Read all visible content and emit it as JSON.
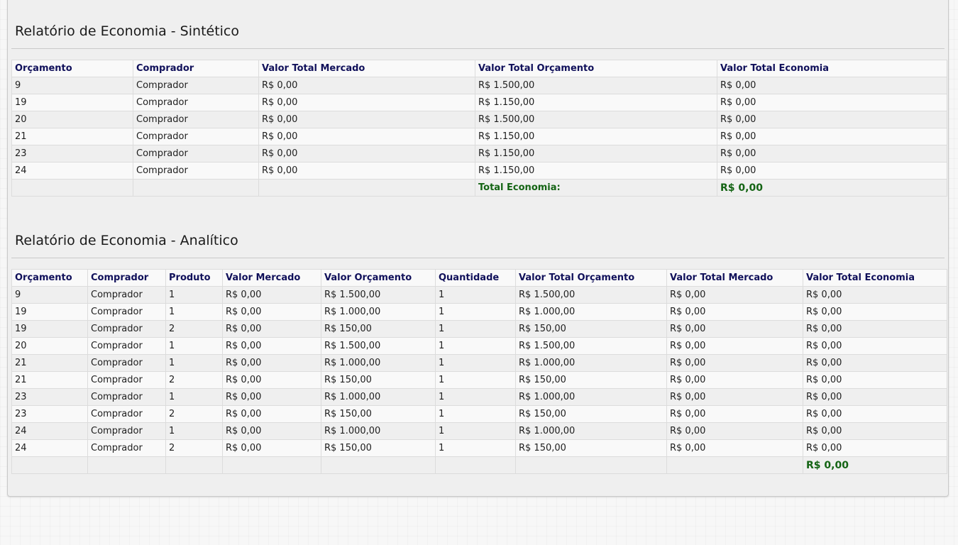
{
  "synthetic": {
    "title": "Relatório de Economia - Sintético",
    "columns": [
      "Orçamento",
      "Comprador",
      "Valor Total Mercado",
      "Valor Total Orçamento",
      "Valor Total Economia"
    ],
    "rows": [
      [
        "9",
        "Comprador",
        "R$ 0,00",
        "R$ 1.500,00",
        "R$ 0,00"
      ],
      [
        "19",
        "Comprador",
        "R$ 0,00",
        "R$ 1.150,00",
        "R$ 0,00"
      ],
      [
        "20",
        "Comprador",
        "R$ 0,00",
        "R$ 1.500,00",
        "R$ 0,00"
      ],
      [
        "21",
        "Comprador",
        "R$ 0,00",
        "R$ 1.150,00",
        "R$ 0,00"
      ],
      [
        "23",
        "Comprador",
        "R$ 0,00",
        "R$ 1.150,00",
        "R$ 0,00"
      ],
      [
        "24",
        "Comprador",
        "R$ 0,00",
        "R$ 1.150,00",
        "R$ 0,00"
      ]
    ],
    "total_label": "Total Economia:",
    "total_value": "R$ 0,00"
  },
  "analytic": {
    "title": "Relatório de Economia - Analítico",
    "columns": [
      "Orçamento",
      "Comprador",
      "Produto",
      "Valor Mercado",
      "Valor Orçamento",
      "Quantidade",
      "Valor Total Orçamento",
      "Valor Total Mercado",
      "Valor Total Economia"
    ],
    "rows": [
      [
        "9",
        "Comprador",
        "1",
        "R$ 0,00",
        "R$ 1.500,00",
        "1",
        "R$ 1.500,00",
        "R$ 0,00",
        "R$ 0,00"
      ],
      [
        "19",
        "Comprador",
        "1",
        "R$ 0,00",
        "R$ 1.000,00",
        "1",
        "R$ 1.000,00",
        "R$ 0,00",
        "R$ 0,00"
      ],
      [
        "19",
        "Comprador",
        "2",
        "R$ 0,00",
        "R$ 150,00",
        "1",
        "R$ 150,00",
        "R$ 0,00",
        "R$ 0,00"
      ],
      [
        "20",
        "Comprador",
        "1",
        "R$ 0,00",
        "R$ 1.500,00",
        "1",
        "R$ 1.500,00",
        "R$ 0,00",
        "R$ 0,00"
      ],
      [
        "21",
        "Comprador",
        "1",
        "R$ 0,00",
        "R$ 1.000,00",
        "1",
        "R$ 1.000,00",
        "R$ 0,00",
        "R$ 0,00"
      ],
      [
        "21",
        "Comprador",
        "2",
        "R$ 0,00",
        "R$ 150,00",
        "1",
        "R$ 150,00",
        "R$ 0,00",
        "R$ 0,00"
      ],
      [
        "23",
        "Comprador",
        "1",
        "R$ 0,00",
        "R$ 1.000,00",
        "1",
        "R$ 1.000,00",
        "R$ 0,00",
        "R$ 0,00"
      ],
      [
        "23",
        "Comprador",
        "2",
        "R$ 0,00",
        "R$ 150,00",
        "1",
        "R$ 150,00",
        "R$ 0,00",
        "R$ 0,00"
      ],
      [
        "24",
        "Comprador",
        "1",
        "R$ 0,00",
        "R$ 1.000,00",
        "1",
        "R$ 1.000,00",
        "R$ 0,00",
        "R$ 0,00"
      ],
      [
        "24",
        "Comprador",
        "2",
        "R$ 0,00",
        "R$ 150,00",
        "1",
        "R$ 150,00",
        "R$ 0,00",
        "R$ 0,00"
      ]
    ],
    "total_value": "R$ 0,00"
  }
}
